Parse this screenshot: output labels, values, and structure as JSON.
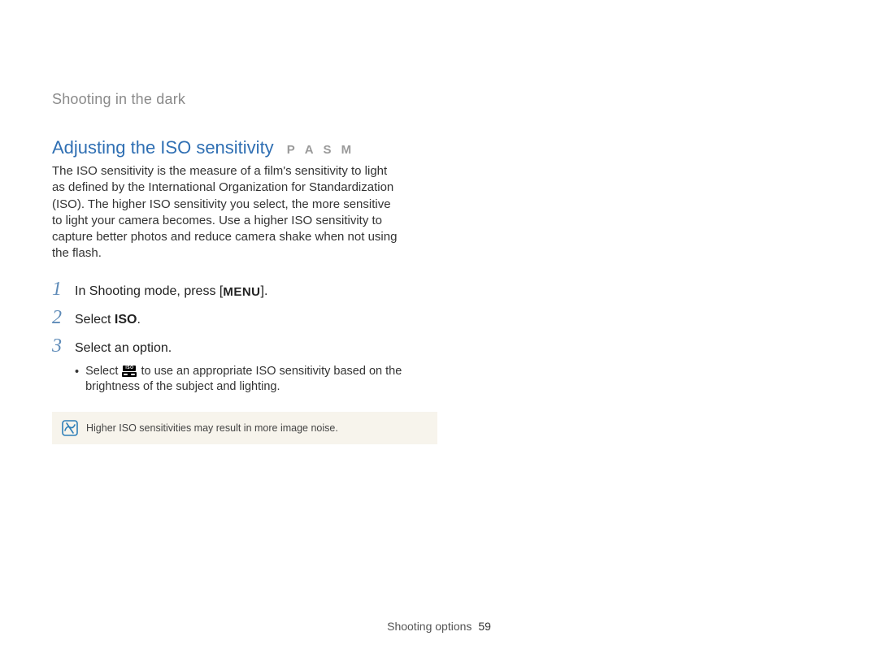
{
  "breadcrumb": "Shooting in the dark",
  "heading": "Adjusting the ISO sensitivity",
  "modes": [
    "P",
    "A",
    "S",
    "M"
  ],
  "intro": "The ISO sensitivity is the measure of a film's sensitivity to light as defined by the International Organization for Standardization (ISO). The higher ISO sensitivity you select, the more sensitive to light your camera becomes. Use a higher ISO sensitivity to capture better photos and reduce camera shake when not using the flash.",
  "steps": {
    "s1": {
      "num": "1",
      "before": "In Shooting mode, press [",
      "menu_label": "MENU",
      "after": "]."
    },
    "s2": {
      "num": "2",
      "before": "Select ",
      "bold": "ISO",
      "after": "."
    },
    "s3": {
      "num": "3",
      "text": "Select an option."
    }
  },
  "sub_bullet": {
    "before": "Select ",
    "icon_name": "iso-auto-icon",
    "after": " to use an appropriate ISO sensitivity based on the brightness of the subject and lighting."
  },
  "note": "Higher ISO sensitivities may result in more image noise.",
  "footer": {
    "section": "Shooting options",
    "page": "59"
  }
}
